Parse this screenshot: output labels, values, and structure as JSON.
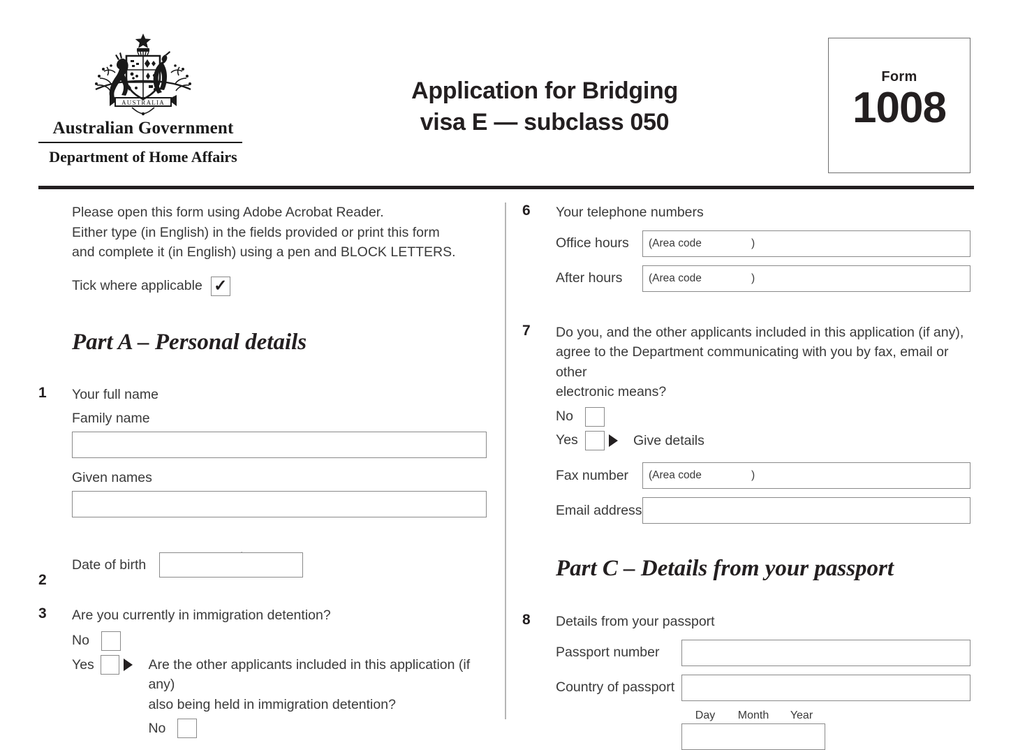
{
  "header": {
    "coat_of_arms": "australian-coat-of-arms",
    "government_name": "Australian Government",
    "department_name": "Department of Home Affairs",
    "title_line1": "Application for Bridging",
    "title_line2": "visa E — subclass 050",
    "form_word": "Form",
    "form_number": "1008"
  },
  "instructions": {
    "line1": "Please open this form using Adobe Acrobat Reader.",
    "line2": "Either type (in English) in the fields provided or print this form",
    "line3": "and complete it (in English) using a pen and BLOCK LETTERS.",
    "tick_label": "Tick where applicable",
    "tick_checked": true
  },
  "parts": {
    "a": "Part A – Personal details",
    "c": "Part C – Details from your passport"
  },
  "date_labels": {
    "day": "Day",
    "month": "Month",
    "year": "Year"
  },
  "options": {
    "no": "No",
    "yes": "Yes"
  },
  "hints": {
    "area_code": "(Area code",
    "area_code_close": ")"
  },
  "questions": {
    "q1": {
      "number": "1",
      "text": "Your full name",
      "family_label": "Family name",
      "family_value": "",
      "given_label": "Given names",
      "given_value": ""
    },
    "q2": {
      "number": "2",
      "text": "Date of birth",
      "value": ""
    },
    "q3": {
      "number": "3",
      "text": "Are you currently in immigration detention?",
      "follow_line1": "Are the other applicants included in this application (if any)",
      "follow_line2": "also being held in immigration detention?",
      "follow_no": "No"
    },
    "q6": {
      "number": "6",
      "text": "Your telephone numbers",
      "office_label": "Office hours",
      "office_value": "",
      "after_label": "After hours",
      "after_value": ""
    },
    "q7": {
      "number": "7",
      "text_line1": "Do you, and the other applicants included in this application (if any),",
      "text_line2": "agree to the Department communicating with you by fax, email or other",
      "text_line3": "electronic means?",
      "give_details": "Give details",
      "fax_label": "Fax number",
      "fax_value": "",
      "email_label": "Email address",
      "email_value": ""
    },
    "q8": {
      "number": "8",
      "text": "Details from your passport",
      "passport_number_label": "Passport number",
      "passport_number_value": "",
      "country_label": "Country of passport",
      "country_value": ""
    }
  }
}
